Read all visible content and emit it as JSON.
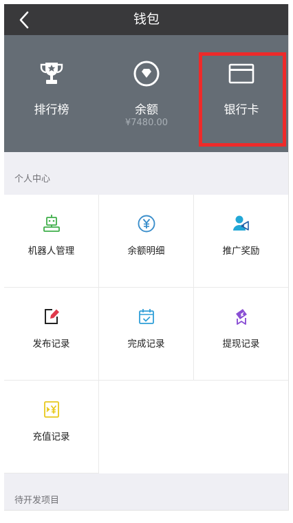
{
  "header": {
    "title": "钱包"
  },
  "top": {
    "items": [
      {
        "label": "排行榜",
        "icon": "trophy-icon"
      },
      {
        "label": "余额",
        "sub": "¥7480.00",
        "icon": "diamond-icon"
      },
      {
        "label": "银行卡",
        "icon": "bank-card-icon"
      }
    ]
  },
  "sections": {
    "personal": "个人中心",
    "pending": "待开发项目"
  },
  "grid": {
    "items": [
      {
        "label": "机器人管理",
        "icon": "robot-icon",
        "color": "#3fae49"
      },
      {
        "label": "余额明细",
        "icon": "yen-circle-icon",
        "color": "#3a8ecb"
      },
      {
        "label": "推广奖励",
        "icon": "promotion-icon",
        "color": "#22a7d6"
      },
      {
        "label": "发布记录",
        "icon": "edit-doc-icon",
        "color": "#e0394b"
      },
      {
        "label": "完成记录",
        "icon": "calendar-check-icon",
        "color": "#2f9fd8"
      },
      {
        "label": "提现记录",
        "icon": "withdraw-icon",
        "color": "#8a4fd4"
      },
      {
        "label": "充值记录",
        "icon": "recharge-icon",
        "color": "#e8c81c"
      }
    ]
  },
  "colors": {
    "header_bg": "#39393b",
    "panel_bg": "#656d75",
    "highlight": "#ee2a2a",
    "page_bg": "#efeff4"
  }
}
